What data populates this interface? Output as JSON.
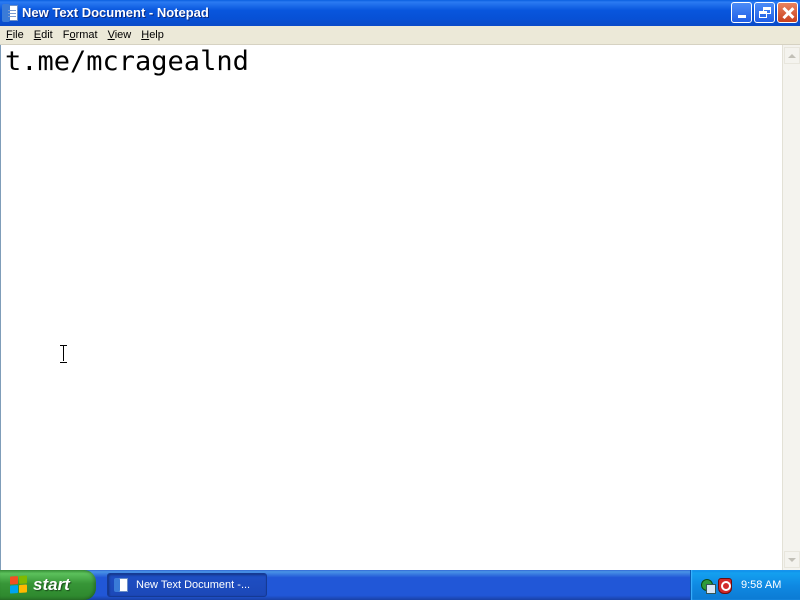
{
  "window": {
    "title": "New Text Document - Notepad",
    "icon": "notepad-icon"
  },
  "menu": {
    "items": [
      {
        "label": "File",
        "hotkey": "F"
      },
      {
        "label": "Edit",
        "hotkey": "E"
      },
      {
        "label": "Format",
        "hotkey": "o"
      },
      {
        "label": "View",
        "hotkey": "V"
      },
      {
        "label": "Help",
        "hotkey": "H"
      }
    ]
  },
  "editor": {
    "content": "t.me/mcragealnd"
  },
  "taskbar": {
    "start_label": "start",
    "task_item_label": "New Text Document -...",
    "clock": "9:58 AM"
  },
  "colors": {
    "titlebar": "#0856dd",
    "menubar": "#ece9d8",
    "taskbar": "#2157d7",
    "start_button": "#379637",
    "tray": "#0f8ae3",
    "close_button": "#c9401e"
  }
}
